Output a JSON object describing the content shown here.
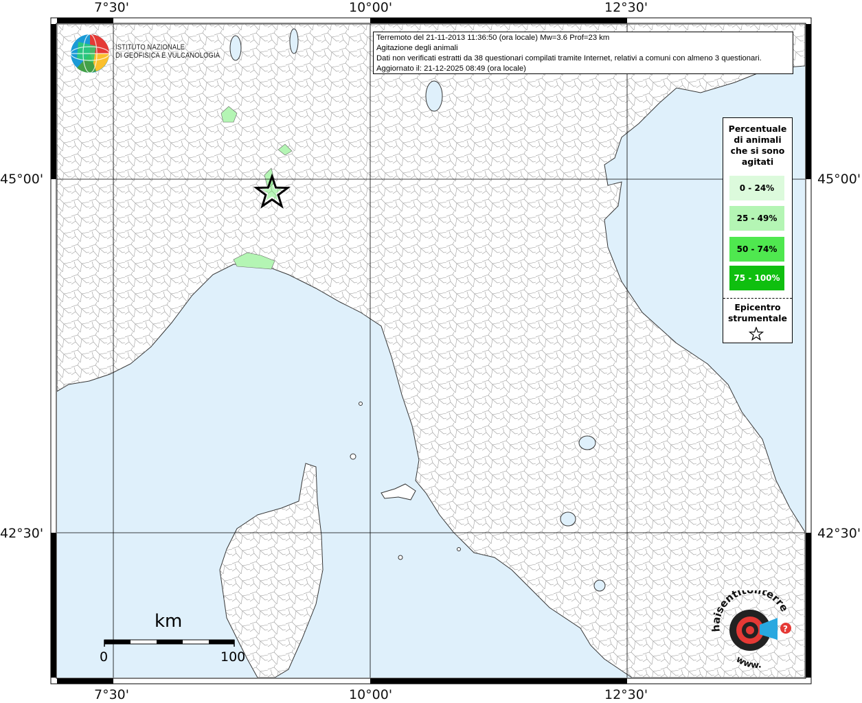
{
  "map": {
    "lon_ticks": [
      "7°30'",
      "10°00'",
      "12°30'"
    ],
    "lat_ticks": [
      "45°00'",
      "42°30'"
    ],
    "colors": {
      "sea": "#dff0fb",
      "land": "#ffffff",
      "borders": "#8a8a8a",
      "grid": "#000000"
    }
  },
  "title_box": {
    "line1": "Terremoto del 21-11-2013 11:36:50 (ora locale) Mw=3.6 Prof=23 km",
    "line2": "Agitazione degli animali",
    "line3": "Dati non verificati estratti da 38 questionari compilati tramite Internet, relativi a comuni con almeno 3 questionari.",
    "line4": "Aggiornato il: 21-12-2025 08:49 (ora locale)"
  },
  "legend": {
    "title_lines": [
      "Percentuale",
      "di animali",
      "che si sono",
      "agitati"
    ],
    "classes": [
      {
        "label": "0 - 24%",
        "color": "#dcfadc"
      },
      {
        "label": "25 - 49%",
        "color": "#b4f5b4"
      },
      {
        "label": "50 - 74%",
        "color": "#4fe84f"
      },
      {
        "label": "75 - 100%",
        "color": "#0fbf0f"
      }
    ],
    "epicenter_lines": [
      "Epicentro",
      "strumentale"
    ]
  },
  "logo": {
    "ingv_line1": "ISTITUTO NAZIONALE",
    "ingv_line2": "DI GEOFISICA E VULCANOLOGIA",
    "hst_text": "haisentitoilterremoto.it",
    "hst_url": "www."
  },
  "scale_bar": {
    "unit": "km",
    "start": "0",
    "end": "100"
  }
}
